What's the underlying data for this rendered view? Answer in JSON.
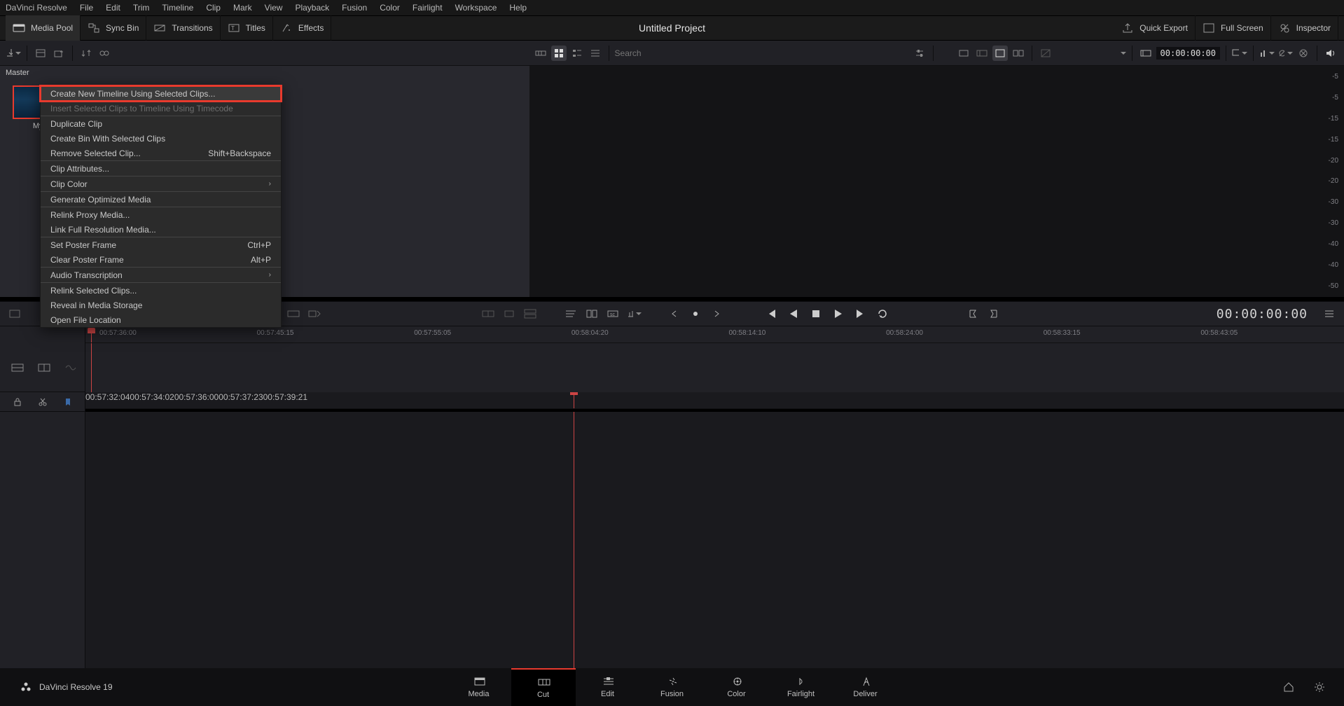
{
  "menubar": [
    "DaVinci Resolve",
    "File",
    "Edit",
    "Trim",
    "Timeline",
    "Clip",
    "Mark",
    "View",
    "Playback",
    "Fusion",
    "Color",
    "Fairlight",
    "Workspace",
    "Help"
  ],
  "toolbarA": {
    "media_pool": "Media Pool",
    "sync_bin": "Sync Bin",
    "transitions": "Transitions",
    "titles": "Titles",
    "effects": "Effects",
    "project_title": "Untitled Project",
    "quick_export": "Quick Export",
    "full_screen": "Full Screen",
    "inspector": "Inspector"
  },
  "toolbarB": {
    "search_placeholder": "Search",
    "timecode": "00:00:00:00"
  },
  "mediaPool": {
    "bin": "Master",
    "clip_label": "My Vi"
  },
  "dbScale": [
    "-5",
    "-5",
    "-15",
    "-15",
    "-20",
    "-20",
    "-30",
    "-30",
    "-40",
    "-40",
    "-50"
  ],
  "contextMenu": {
    "items": [
      {
        "label": "Create New Timeline Using Selected Clips...",
        "highlight": true,
        "hover": true
      },
      {
        "label": "Insert Selected Clips to Timeline Using Timecode",
        "disabled": true
      },
      {
        "sep": true
      },
      {
        "label": "Duplicate Clip"
      },
      {
        "label": "Create Bin With Selected Clips"
      },
      {
        "label": "Remove Selected Clip...",
        "shortcut": "Shift+Backspace"
      },
      {
        "sep": true
      },
      {
        "label": "Clip Attributes..."
      },
      {
        "sep": true
      },
      {
        "label": "Clip Color",
        "submenu": true
      },
      {
        "sep": true
      },
      {
        "label": "Generate Optimized Media"
      },
      {
        "sep": true
      },
      {
        "label": "Relink Proxy Media..."
      },
      {
        "label": "Link Full Resolution Media..."
      },
      {
        "sep": true
      },
      {
        "label": "Set Poster Frame",
        "shortcut": "Ctrl+P"
      },
      {
        "label": "Clear Poster Frame",
        "shortcut": "Alt+P"
      },
      {
        "sep": true
      },
      {
        "label": "Audio Transcription",
        "submenu": true
      },
      {
        "sep": true
      },
      {
        "label": "Relink Selected Clips..."
      },
      {
        "label": "Reveal in Media Storage"
      },
      {
        "label": "Open File Location"
      }
    ]
  },
  "mid": {
    "big_tc": "00:00:00:00"
  },
  "ruler1": [
    "00:57:36:00",
    "00:57:45:15",
    "00:57:55:05",
    "00:58:04:20",
    "00:58:14:10",
    "00:58:24:00",
    "00:58:33:15",
    "00:58:43:05"
  ],
  "ruler2": [
    "00:57:32:04",
    "00:57:34:02",
    "00:57:36:00",
    "00:57:37:23",
    "00:57:39:21"
  ],
  "pages": {
    "branding": "DaVinci Resolve 19",
    "tabs": [
      "Media",
      "Cut",
      "Edit",
      "Fusion",
      "Color",
      "Fairlight",
      "Deliver"
    ],
    "active": 1
  }
}
